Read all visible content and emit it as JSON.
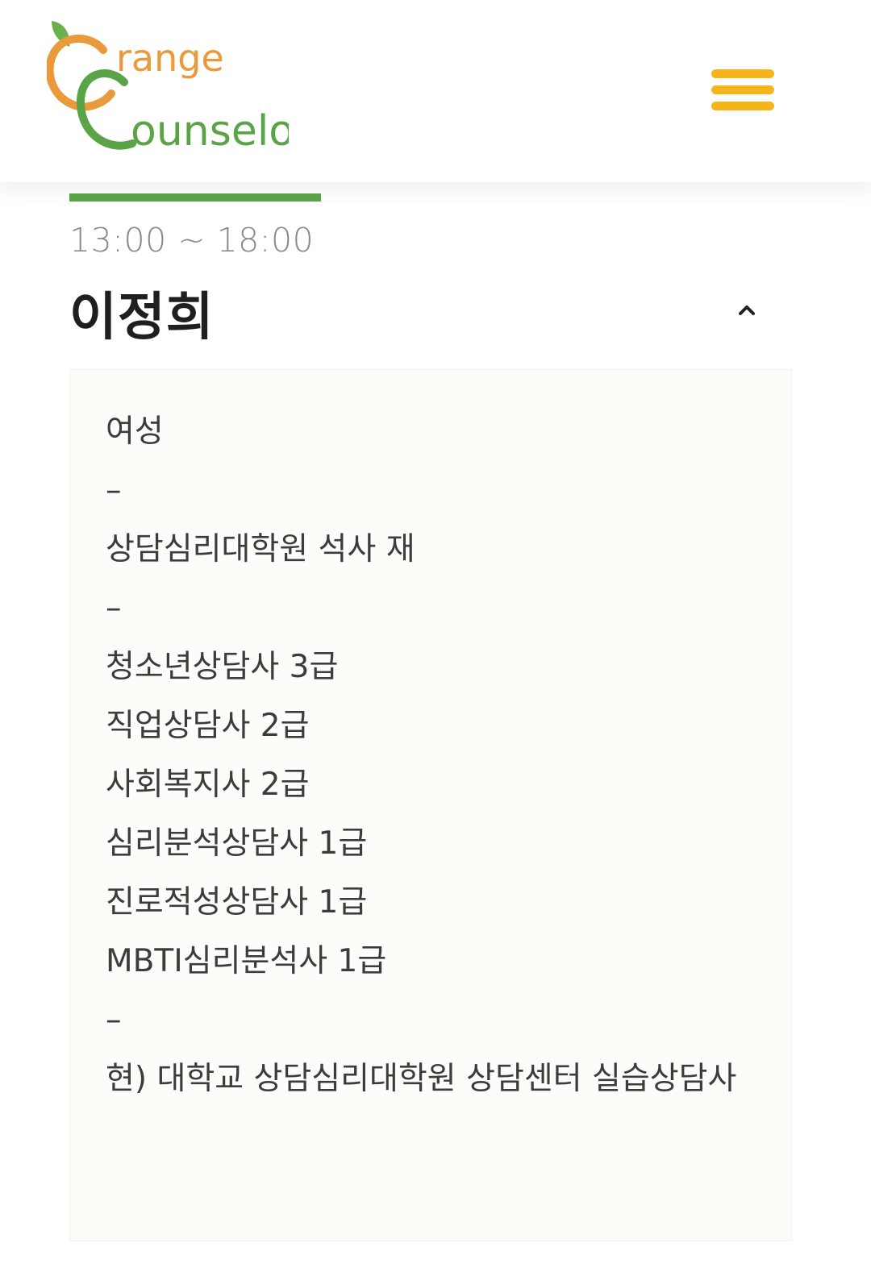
{
  "header": {
    "logo": {
      "line1": "range",
      "line2": "ounselor",
      "brand_full": "Orange Counselor",
      "colors": {
        "orange": "#ea9a3a",
        "green": "#5aa447",
        "leaf": "#6ab04c"
      }
    },
    "menu_icon": "hamburger-menu-icon",
    "menu_color": "#f3b51a"
  },
  "counselor": {
    "time": "13:00 ~ 18:00",
    "name": "이정희",
    "toggle_icon": "chevron-up-icon",
    "accent_bar_color": "#5aa447",
    "details": [
      "여성",
      "–",
      "상담심리대학원 석사 재",
      "–",
      "청소년상담사 3급",
      "직업상담사 2급",
      "사회복지사 2급",
      "심리분석상담사 1급",
      "진로적성상담사 1급",
      "MBTI심리분석사 1급",
      "–",
      "현) 대학교 상담심리대학원 상담센터 실습상담사"
    ]
  }
}
